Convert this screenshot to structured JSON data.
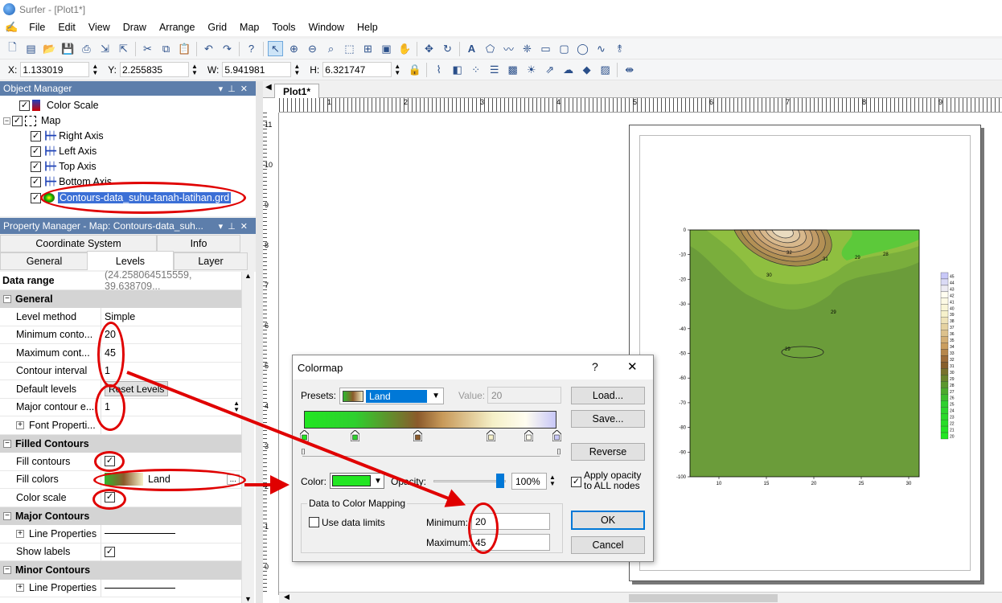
{
  "title": "Surfer - [Plot1*]",
  "menu": [
    "File",
    "Edit",
    "View",
    "Draw",
    "Arrange",
    "Grid",
    "Map",
    "Tools",
    "Window",
    "Help"
  ],
  "coords": {
    "x_label": "X:",
    "x": "1.133019",
    "y_label": "Y:",
    "y": "2.255835",
    "w_label": "W:",
    "w": "5.941981",
    "h_label": "H:",
    "h": "6.321747"
  },
  "object_manager": {
    "title": "Object Manager",
    "items": [
      "Color Scale",
      "Map",
      "Right Axis",
      "Left Axis",
      "Top Axis",
      "Bottom Axis",
      "Contours-data_suhu-tanah-latihan.grd"
    ]
  },
  "property_manager": {
    "title": "Property Manager - Map: Contours-data_suh...",
    "tabs": [
      "Coordinate System",
      "Info",
      "General",
      "Levels",
      "Layer"
    ],
    "data_range_label": "Data range",
    "data_range_value": "(24.258064515559, 39.638709...",
    "general": "General",
    "level_method_k": "Level method",
    "level_method_v": "Simple",
    "min_k": "Minimum conto...",
    "min_v": "20",
    "max_k": "Maximum cont...",
    "max_v": "45",
    "interval_k": "Contour interval",
    "interval_v": "1",
    "default_k": "Default levels",
    "default_btn": "Reset Levels",
    "major_e_k": "Major contour e...",
    "major_e_v": "1",
    "font_k": "Font Properti...",
    "filled": "Filled Contours",
    "fill_contours_k": "Fill contours",
    "fill_colors_k": "Fill colors",
    "fill_colors_v": "Land",
    "color_scale_k": "Color scale",
    "major": "Major Contours",
    "line_k": "Line Properties",
    "labels_k": "Show labels",
    "minor": "Minor Contours",
    "line2_k": "Line Properties"
  },
  "doc_tab": "Plot1*",
  "chart": {
    "y_ticks": [
      "0",
      "-10",
      "-20",
      "-30",
      "-40",
      "-50",
      "-60",
      "-70",
      "-80",
      "-90",
      "-100"
    ],
    "x_ticks": [
      "10",
      "15",
      "20",
      "25",
      "30"
    ],
    "contour_labels": [
      "32",
      "31",
      "30",
      "29",
      "28",
      "29",
      "29"
    ],
    "scale_labels": [
      "45",
      "44",
      "43",
      "42",
      "41",
      "40",
      "39",
      "38",
      "37",
      "36",
      "35",
      "34",
      "33",
      "32",
      "31",
      "30",
      "29",
      "28",
      "27",
      "26",
      "25",
      "24",
      "23",
      "22",
      "21",
      "20"
    ],
    "ruler_h": [
      "1",
      "2",
      "3",
      "4",
      "5",
      "6",
      "7",
      "8",
      "9"
    ],
    "ruler_v": [
      "11",
      "10",
      "9",
      "8",
      "7",
      "6",
      "5",
      "4",
      "3",
      "2",
      "1",
      "0"
    ]
  },
  "colormap": {
    "title": "Colormap",
    "help": "?",
    "close": "✕",
    "presets_label": "Presets:",
    "preset": "Land",
    "value_label": "Value:",
    "value": "20",
    "load": "Load...",
    "save": "Save...",
    "reverse": "Reverse",
    "color_label": "Color:",
    "opacity_label": "Opacity:",
    "opacity": "100%",
    "apply_opacity": "Apply opacity to ALL nodes",
    "mapping_group": "Data to Color Mapping",
    "use_limits": "Use data limits",
    "min_label": "Minimum:",
    "min": "20",
    "max_label": "Maximum:",
    "max": "45",
    "ok": "OK",
    "cancel": "Cancel"
  }
}
